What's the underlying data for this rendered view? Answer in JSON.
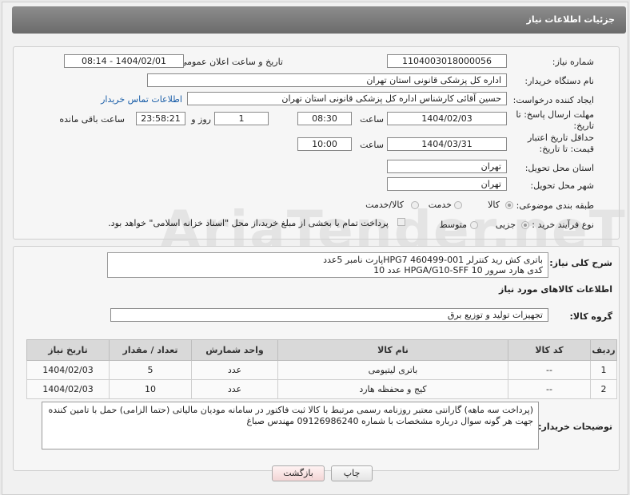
{
  "header": {
    "title": "جزئیات اطلاعات نیاز"
  },
  "form": {
    "need_number_label": "شماره نیاز:",
    "need_number": "1104003018000056",
    "announce_label": "تاریخ و ساعت اعلان عمومی:",
    "announce_value": "1404/02/01 - 08:14",
    "buyer_label": "نام دستگاه خریدار:",
    "buyer_value": "اداره کل پزشکی قانونی استان تهران",
    "creator_label": "ایجاد کننده درخواست:",
    "creator_value": "حسین آقائی کارشناس اداره کل پزشکی قانونی استان تهران",
    "contact_link": "اطلاعات تماس خریدار",
    "deadline_label": "مهلت ارسال پاسخ: تا تاریخ:",
    "deadline_date": "1404/02/03",
    "time_label": "ساعت",
    "deadline_time": "08:30",
    "days_value": "1",
    "days_label": "روز و",
    "remaining_value": "23:58:21",
    "remaining_label": "ساعت باقی مانده",
    "price_label": "حداقل تاریخ اعتبار قیمت: تا تاریخ:",
    "price_date": "1404/03/31",
    "price_time": "10:00",
    "province_label": "استان محل تحویل:",
    "province_value": "تهران",
    "city_label": "شهر محل تحویل:",
    "city_value": "تهران",
    "category_label": "طبقه بندی موضوعی:",
    "category_options": [
      "کالا",
      "خدمت",
      "کالا/خدمت"
    ],
    "process_label": "نوع فرآیند خرید :",
    "process_options": [
      "جزیی",
      "متوسط"
    ],
    "payment_note": "پرداخت تمام یا بخشی از مبلغ خرید،از محل \"اسناد خزانه اسلامی\" خواهد بود."
  },
  "description": {
    "label": "شرح کلی نیاز:",
    "line1": "باتری کش رید کنترلر HPG7 460499-001پارت نامبر 5عدد",
    "line2": "کدی هارد سرور HPGA/G10-SFF 10  عدد 10"
  },
  "goods": {
    "section_title": "اطلاعات کالاهای مورد نیاز",
    "group_label": "گروه کالا:",
    "group_value": "تجهیزات تولید و توزیع برق",
    "columns": [
      "ردیف",
      "کد کالا",
      "نام کالا",
      "واحد شمارش",
      "تعداد / مقدار",
      "تاریخ نیاز"
    ],
    "rows": [
      {
        "row": "1",
        "code": "--",
        "name": "باتری لیتیومی",
        "unit": "عدد",
        "qty": "5",
        "date": "1404/02/03"
      },
      {
        "row": "2",
        "code": "--",
        "name": "کیج و محفظه هارد",
        "unit": "عدد",
        "qty": "10",
        "date": "1404/02/03"
      }
    ]
  },
  "buyer_notes": {
    "label": "توضیحات خریدار:",
    "text": "(پرداخت سه ماهه) گارانتی معتبر روزنامه رسمی مرتبط با کالا ثبت فاکتور در سامانه مودیان مالیاتی (حتما الزامی) حمل با تامین کننده جهت هر گونه سوال درباره مشخصات با شماره 09126986240 مهندس صباغ"
  },
  "buttons": {
    "print": "چاپ",
    "back": "بازگشت"
  },
  "watermark": "AriaTender.neT"
}
